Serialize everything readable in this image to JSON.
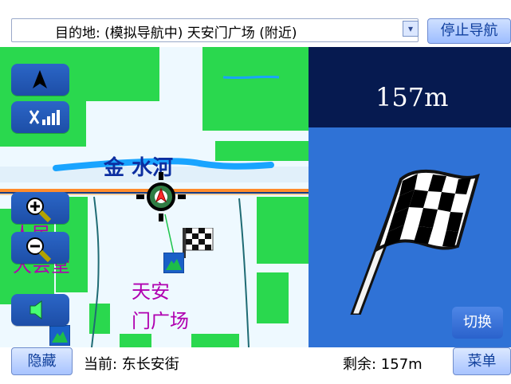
{
  "header": {
    "destination_text": "目的地: (模拟导航中) 天安门广场 (附近)",
    "dropdown_label": "▾",
    "stop_navigation_label": "停止导航"
  },
  "map": {
    "labels": {
      "river": "金  水河",
      "left_vertical_1": "人民",
      "left_vertical_2": "大会堂",
      "place_1": "天安",
      "place_2": "门广场"
    }
  },
  "navigation": {
    "distance": "157m",
    "switch_label": "切换"
  },
  "footer": {
    "hide_label": "隐藏",
    "current_label": "当前: 东长安街",
    "remaining_label": "剩余: 157m",
    "menu_label": "菜单"
  },
  "icons": [
    "north-arrow-icon",
    "gps-signal-icon",
    "zoom-in-icon",
    "zoom-out-icon",
    "volume-icon",
    "checkered-flag-icon",
    "vehicle-position-icon"
  ],
  "colors": {
    "map_bg": "#eef9ff",
    "park_green": "#21d84a",
    "road_orange": "#ff8b2b",
    "road_dark": "#163d84",
    "water_blue": "#17a6ff",
    "panel_blue": "#2f72d6",
    "panel_dark": "#061a50"
  }
}
